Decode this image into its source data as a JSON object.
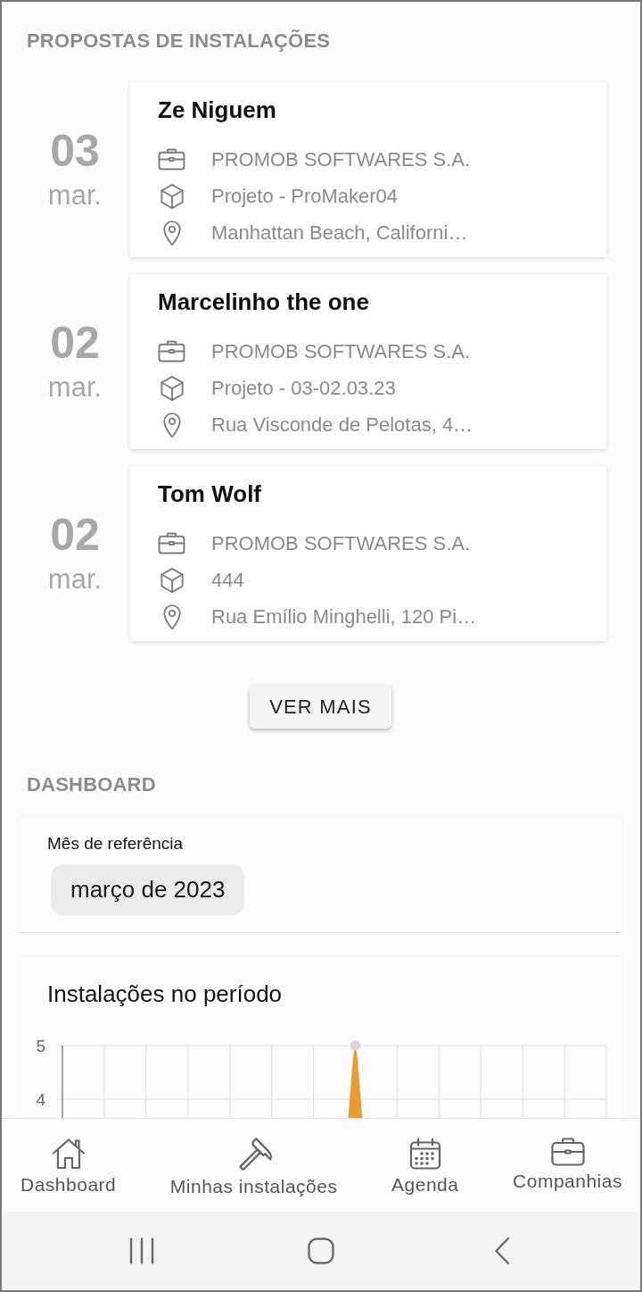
{
  "section_title": "PROPOSTAS DE INSTALAÇÕES",
  "proposals": [
    {
      "day": "03",
      "month": "mar.",
      "client": "Ze Niguem",
      "details": [
        {
          "kind": "company",
          "text": "PROMOB SOFTWARES S.A."
        },
        {
          "kind": "project",
          "text": "Projeto - ProMaker04"
        },
        {
          "kind": "address",
          "text": "Manhattan Beach, Californi…"
        }
      ]
    },
    {
      "day": "02",
      "month": "mar.",
      "client": "Marcelinho the one",
      "details": [
        {
          "kind": "company",
          "text": "PROMOB SOFTWARES S.A."
        },
        {
          "kind": "project",
          "text": "Projeto - 03-02.03.23"
        },
        {
          "kind": "address",
          "text": "Rua Visconde de Pelotas, 4…"
        }
      ]
    },
    {
      "day": "02",
      "month": "mar.",
      "client": "Tom Wolf",
      "details": [
        {
          "kind": "company",
          "text": "PROMOB SOFTWARES S.A."
        },
        {
          "kind": "project",
          "text": "444"
        },
        {
          "kind": "address",
          "text": "Rua Emílio Minghelli, 120 Pi…"
        }
      ]
    }
  ],
  "more_button": "VER MAIS",
  "dashboard": {
    "title": "DASHBOARD",
    "month_filter": {
      "label": "Mês de referência",
      "value": "março de 2023"
    },
    "chart": {
      "title": "Instalações no período",
      "y_labels": [
        "5",
        "4"
      ]
    }
  },
  "bottom_nav": [
    {
      "kind": "home",
      "label": "Dashboard"
    },
    {
      "kind": "tools",
      "label": "Minhas instalações"
    },
    {
      "kind": "calendar",
      "label": "Agenda"
    },
    {
      "kind": "companies",
      "label": "Companhias"
    }
  ]
}
